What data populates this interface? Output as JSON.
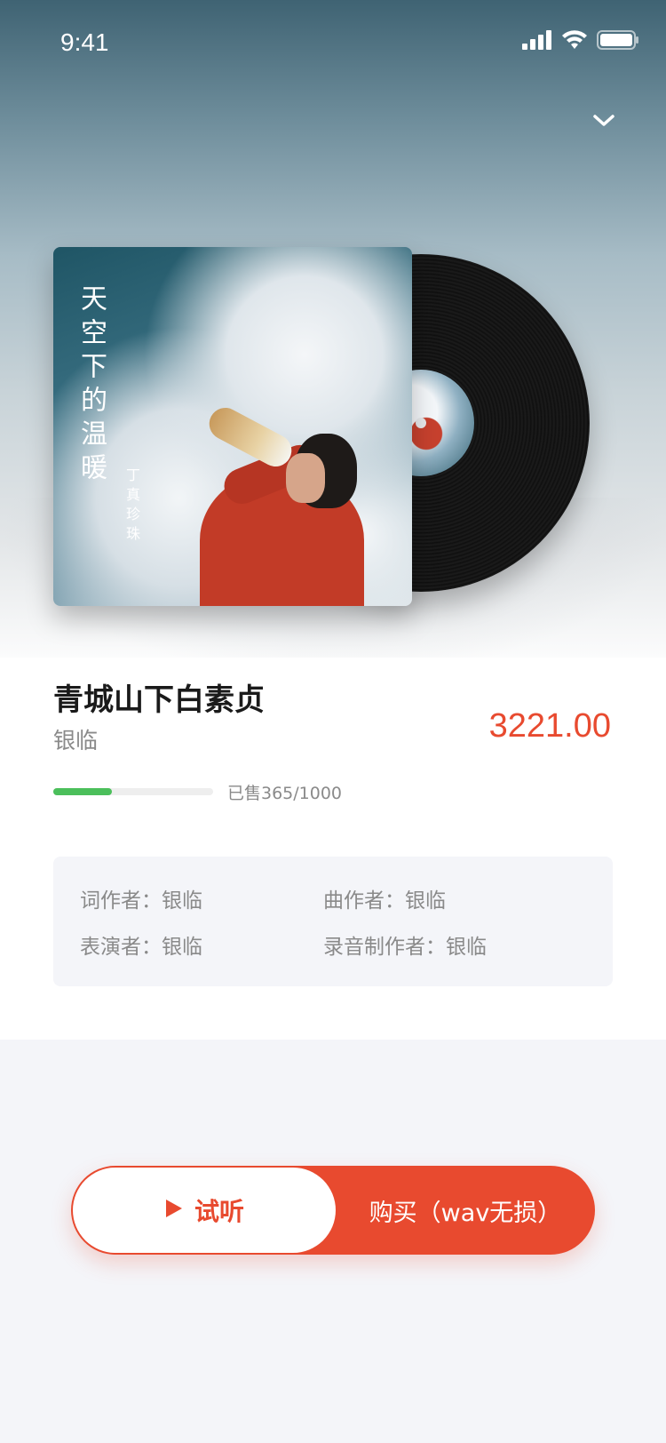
{
  "status_bar": {
    "time": "9:41"
  },
  "album": {
    "cover_title": "天空下的温暖",
    "cover_artist": "丁真珍珠"
  },
  "song": {
    "title": "青城山下白素贞",
    "artist": "银临",
    "price": "3221.00",
    "sold_text": "已售365/1000",
    "sold_fraction": 0.365
  },
  "credits": {
    "lyricist": "词作者：银临",
    "composer": "曲作者：银临",
    "performer": "表演者：银临",
    "producer": "录音制作者：银临"
  },
  "actions": {
    "preview_label": "试听",
    "buy_label": "购买（wav无损）"
  },
  "colors": {
    "accent": "#e84a2f",
    "progress": "#4bbf5b",
    "muted_text": "#8a8a8a",
    "panel_bg": "#f4f5f9"
  },
  "icons": {
    "collapse": "chevron-down-icon",
    "play": "play-icon",
    "signal": "signal-icon",
    "wifi": "wifi-icon",
    "battery": "battery-icon"
  }
}
